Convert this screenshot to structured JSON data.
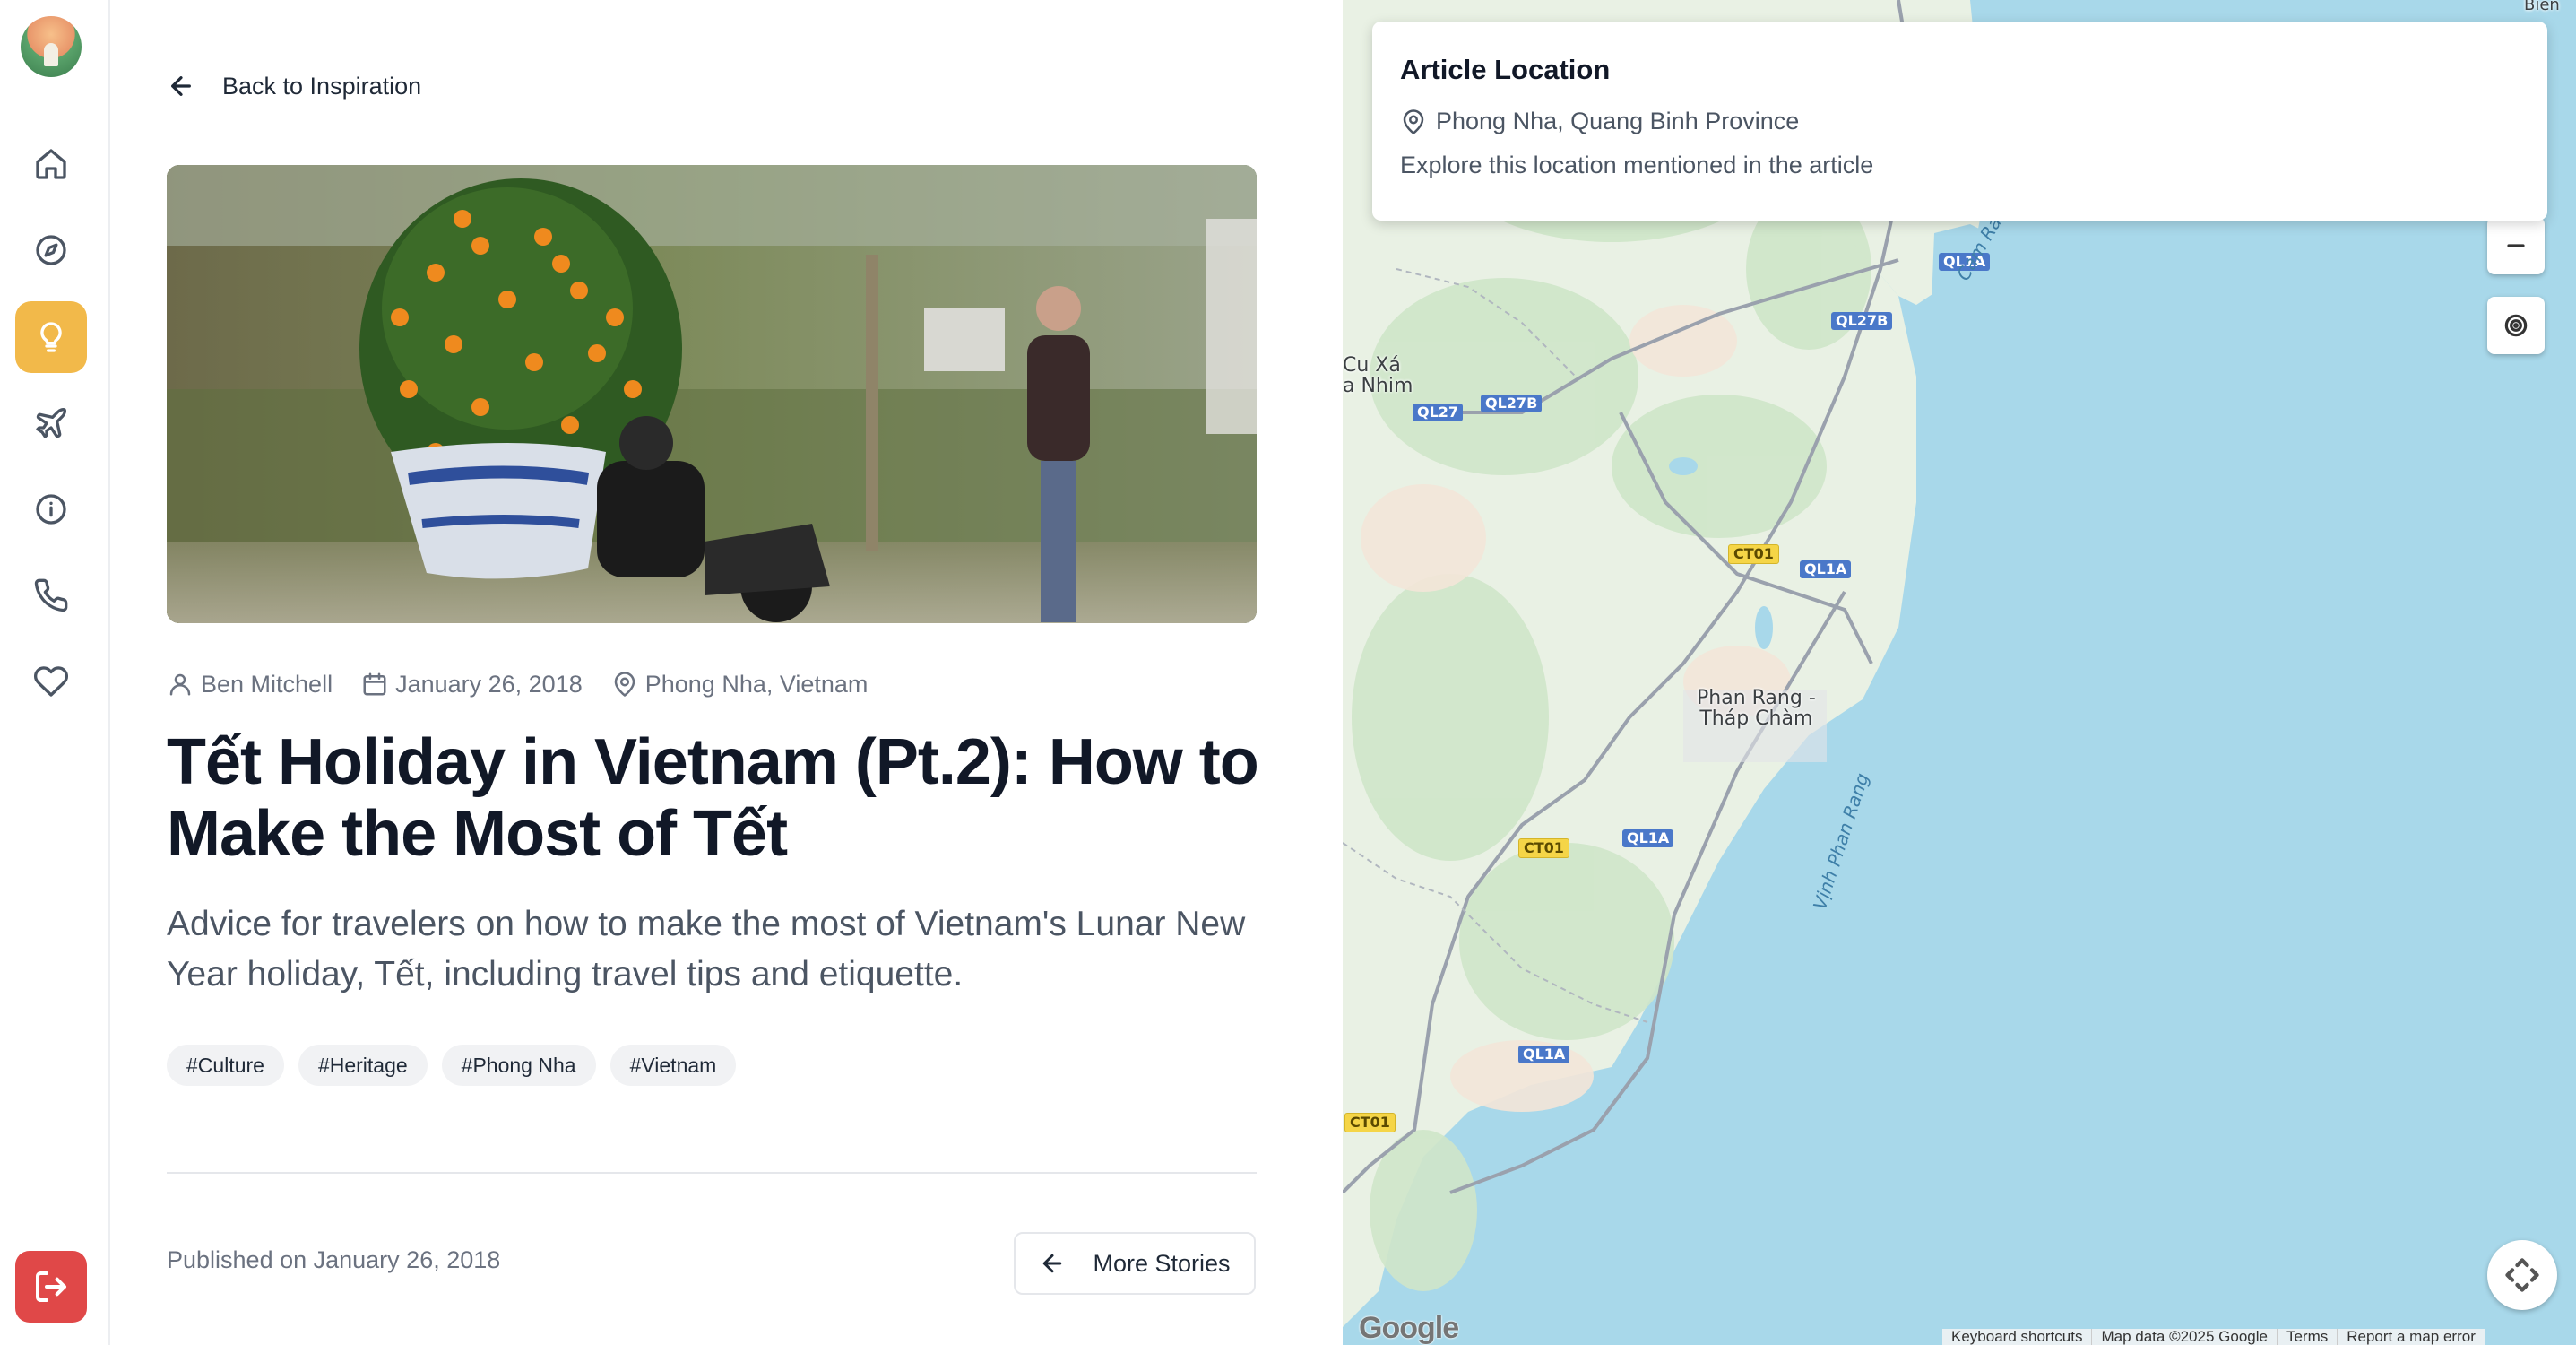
{
  "sidebar": {
    "items": [
      {
        "name": "home",
        "icon": "home-icon"
      },
      {
        "name": "explore",
        "icon": "compass-icon"
      },
      {
        "name": "inspiration",
        "icon": "lightbulb-icon",
        "active": true
      },
      {
        "name": "trips",
        "icon": "plane-icon"
      },
      {
        "name": "about",
        "icon": "info-icon"
      },
      {
        "name": "contact",
        "icon": "phone-icon"
      },
      {
        "name": "favorites",
        "icon": "heart-icon"
      }
    ],
    "logout_icon": "logout-icon",
    "active_color": "#f2b94a",
    "logout_color": "#e04848"
  },
  "article": {
    "back_label": "Back to Inspiration",
    "author": "Ben Mitchell",
    "date": "January 26, 2018",
    "location": "Phong Nha, Vietnam",
    "title": "Tết Holiday in Vietnam (Pt.2): How to Make the Most of Tết",
    "subtitle": "Advice for travelers on how to make the most of Vietnam's Lunar New Year holiday, Tết, including travel tips and etiquette.",
    "tags": [
      "#Culture",
      "#Heritage",
      "#Phong Nha",
      "#Vietnam"
    ],
    "published": "Published on January 26, 2018",
    "more_label": "More Stories"
  },
  "location_card": {
    "title": "Article Location",
    "place": "Phong Nha, Quang Binh Province",
    "description": "Explore this location mentioned in the article"
  },
  "map": {
    "zoom_out_label": "−",
    "places": [
      "Cu Xá\na Nhim",
      "Phan Rang -\nTháp Chàm"
    ],
    "water_labels": [
      "Cam Ranh Bay",
      "Vịnh Phan Rang"
    ],
    "roads": [
      "QL1A",
      "QL27B",
      "QL27B",
      "QL27",
      "CT01",
      "QL1A",
      "CT01",
      "QL1A",
      "QL1A",
      "CT01"
    ],
    "top_right_label": "Bìen",
    "google": "Google",
    "attribution": [
      "Keyboard shortcuts",
      "Map data ©2025 Google",
      "Terms",
      "Report a map error"
    ]
  }
}
